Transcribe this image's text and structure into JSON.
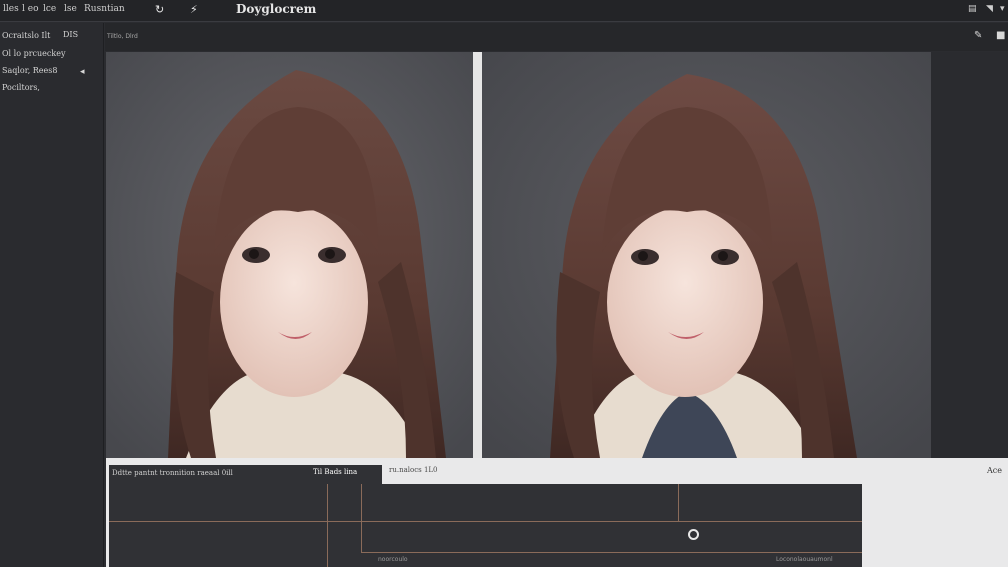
{
  "menubar": {
    "items": [
      "lles",
      "l eo",
      "lce",
      "lse",
      "Rusntian"
    ],
    "app_title": "Doyglocrem"
  },
  "sidebar": {
    "lines": [
      "Ocraitslo Ilt",
      "Ol lo prcueckey",
      "Saqlor, Rees8",
      "Pociltors,"
    ],
    "side_label": "DIS"
  },
  "toolbar2": {
    "breadcrumb": "Tiltlo, Dlrd"
  },
  "timeline": {
    "header_label": "Ddtte pantnt tronnition raeaal 0ill",
    "header_right": "Til Bads lina",
    "info": "ru.nalocs 1L0",
    "right_label": "Ace",
    "tick_left": "noorcoulo",
    "tick_right": "Loconolaouaumonl"
  },
  "colors": {
    "background": "#2b2c30",
    "panel_gray": "#55565b",
    "timeline_bg": "#303135",
    "accent_line": "#8a6b5a",
    "hair": "#5a3a32",
    "skin": "#efd8cf"
  }
}
